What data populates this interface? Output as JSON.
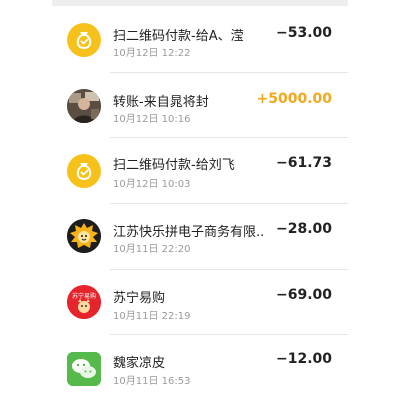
{
  "transactions": [
    {
      "title": "扫二维码付款-给A、滢",
      "time": "10月12日 12:22",
      "amount": "−53.00",
      "icon": "money-bag-icon",
      "color": "#f6c11a"
    },
    {
      "title": "转账-来自晁将封",
      "time": "10月12日 10:16",
      "amount": "+5000.00",
      "icon": "user-photo-avatar",
      "color": "#f2a81d"
    },
    {
      "title": "扫二维码付款-给刘飞",
      "time": "10月12日 10:03",
      "amount": "−61.73",
      "icon": "money-bag-icon",
      "color": "#f6c11a"
    },
    {
      "title": "江苏快乐拼电子商务有限...",
      "time": "10月11日 22:20",
      "amount": "−28.00",
      "icon": "lion-logo-icon",
      "color": "#f7b21a"
    },
    {
      "title": "苏宁易购",
      "time": "10月11日 22:19",
      "amount": "−69.00",
      "icon": "suning-logo-icon",
      "color": "#e6242b",
      "logo_text": "苏宁易购"
    },
    {
      "title": "魏家凉皮",
      "time": "10月11日 16:53",
      "amount": "−12.00",
      "icon": "wechat-icon",
      "color": "#56b94b"
    }
  ]
}
